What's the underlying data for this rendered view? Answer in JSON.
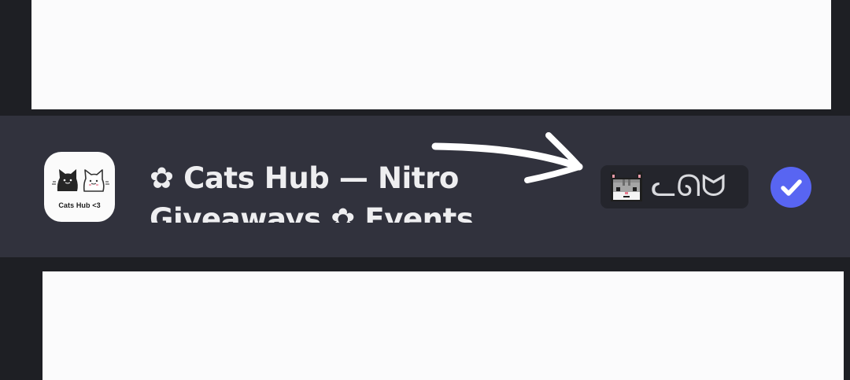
{
  "server": {
    "name": "✿ Cats Hub — Nitro Giveaways ✿ Events •",
    "icon": {
      "caption": "Cats Hub <3"
    },
    "tag": {
      "text": "ᓚᘏᗢ",
      "badge_icon": "pixel-cat-icon"
    },
    "verified_icon": "verified-check-icon"
  },
  "annotation": {
    "arrow_icon": "hand-drawn-arrow-icon"
  },
  "colors": {
    "page_background": "#1e1f24",
    "row_background": "#31323d",
    "tag_background": "#24252c",
    "verified": "#5865f2",
    "panel": "#fbfbfc"
  }
}
